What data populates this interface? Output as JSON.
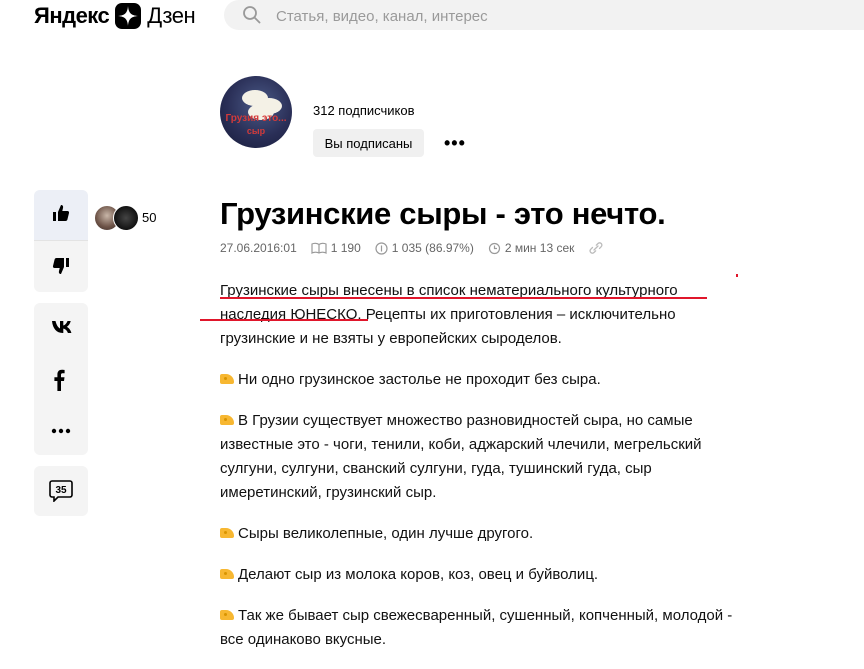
{
  "header": {
    "logo_left": "Яндекс",
    "logo_right": "Дзен",
    "search_placeholder": "Статья, видео, канал, интерес"
  },
  "channel": {
    "avatar_line1": "Грузия это...",
    "avatar_line2": "сыр",
    "subscribers": "312 подписчиков",
    "subscribe_button": "Вы подписаны",
    "more": "•••"
  },
  "sidebar": {
    "likes_count": "50",
    "comments_count": "35"
  },
  "article": {
    "title": "Грузинские сыры - это нечто.",
    "date": "27.06.2016:01",
    "views": "1 190",
    "reads": "1 035 (86.97%)",
    "read_time": "2 мин 13 сек",
    "paragraphs": [
      "Грузинские сыры внесены в список нематериального культурного наследия ЮНЕСКО. Рецепты их приготовления – исключительно грузинские и не взяты у европейских сыроделов.",
      "Ни одно грузинское застолье не проходит без сыра.",
      "В Грузии существует множество разновидностей сыра, но самые известные это - чоги, тенили, коби, аджарский члечили, мегрельский сулгуни, сулгуни, сванский сулгуни, гуда, тушинский гуда, сыр имеретинский, грузинский сыр.",
      "Сыры великолепные, один лучше другого.",
      "Делают сыр из молока коров, коз, овец и буйволиц.",
      "Так же бывает сыр свежесваренный, сушенный, копченный, молодой - все одинаково вкусные."
    ]
  },
  "colors": {
    "accent_red": "#e0162b",
    "panel_bg": "#f4f4f4",
    "search_bg": "#f2f2f2"
  }
}
